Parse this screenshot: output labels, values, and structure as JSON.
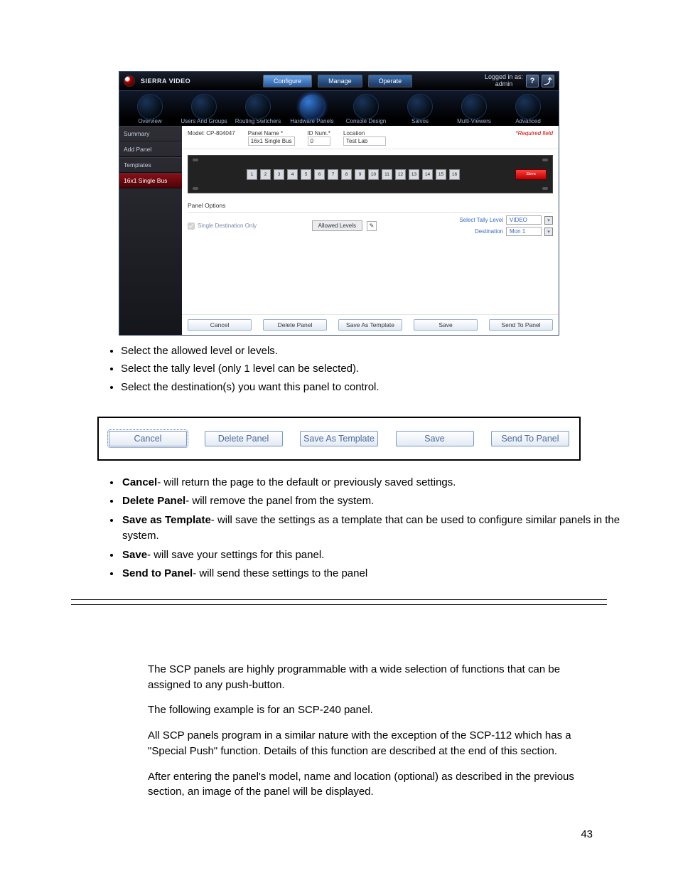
{
  "header": {
    "brand": "SIERRA VIDEO",
    "primary_tabs": [
      "Configure",
      "Manage",
      "Operate"
    ],
    "active_primary": 0,
    "login_line1": "Logged in as:",
    "login_line2": "admin",
    "help_icon": "?",
    "logout_icon": "⤴"
  },
  "subtabs": {
    "items": [
      "Overview",
      "Users And Groups",
      "Routing Switchers",
      "Hardware Panels",
      "Console Design",
      "Salvos",
      "Multi-Viewers",
      "Advanced"
    ],
    "active_index": 3
  },
  "sidebar": {
    "items": [
      "Summary",
      "Add Panel",
      "Templates",
      "16x1 Single Bus"
    ],
    "active_index": 3
  },
  "form": {
    "model_label": "Model: CP-804047",
    "panel_name_label": "Panel Name *",
    "panel_name_value": "16x1 Single Bus",
    "id_label": "ID Num.*",
    "id_value": "0",
    "location_label": "Location",
    "location_value": "Test Lab",
    "required_label": "*Required field"
  },
  "panel": {
    "buttons": [
      "1",
      "2",
      "3",
      "4",
      "5",
      "6",
      "7",
      "8",
      "9",
      "10",
      "11",
      "12",
      "13",
      "14",
      "15",
      "16"
    ],
    "brandchip": "Sierra"
  },
  "options": {
    "section_title": "Panel Options",
    "single_dest": "Single Destination Only",
    "allowed_levels": "Allowed Levels",
    "tally_label": "Select Tally Level",
    "tally_value": "VIDEO",
    "dest_label": "Destination",
    "dest_value": "Mon 1"
  },
  "actions": [
    "Cancel",
    "Delete Panel",
    "Save As Template",
    "Save",
    "Send To Panel"
  ],
  "doc": {
    "bullets_top": [
      "Select the allowed level or levels.",
      "Select the tally level (only 1 level can be selected).",
      "Select the destination(s) you want this panel to control."
    ],
    "btnbar": [
      "Cancel",
      "Delete Panel",
      "Save As Template",
      "Save",
      "Send To Panel"
    ],
    "bullets_desc": [
      {
        "b": "Cancel",
        "t": "- will return the page to the default or previously saved settings."
      },
      {
        "b": "Delete Panel",
        "t": "- will remove the panel from the system."
      },
      {
        "b": "Save as Template",
        "t": "- will save the settings as a template that can be used to configure similar panels in the system."
      },
      {
        "b": "Save",
        "t": "- will save your settings for this panel."
      },
      {
        "b": "Send to Panel",
        "t": "- will send these settings to the panel"
      }
    ],
    "paras": [
      "The SCP panels are highly programmable with a wide selection of functions that can be assigned to any push-button.",
      "The following example is for an SCP-240 panel.",
      "All SCP panels program in a similar nature with the exception of the SCP-112 which has a \"Special Push\" function. Details of this function are described at the end of this section.",
      "After entering the panel's model, name and location (optional) as described in the previous section, an image of the panel will be displayed."
    ],
    "page_number": "43"
  }
}
